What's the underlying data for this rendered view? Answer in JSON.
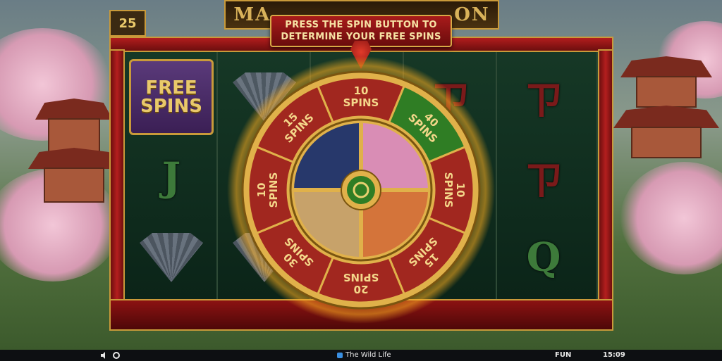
{
  "game": {
    "title_text": "MA",
    "title_text_right": "ON",
    "counter_value": "25",
    "prompt_line1": "PRESS THE SPIN BUTTON TO",
    "prompt_line2": "DETERMINE YOUR FREE SPINS"
  },
  "reels": {
    "symbols": [
      {
        "type": "free_spins",
        "label_top": "FREE",
        "label_bottom": "SPINS"
      },
      {
        "type": "letter",
        "label": "J"
      },
      {
        "type": "fan"
      },
      {
        "type": "fan"
      },
      {
        "type": "letter",
        "label": "Q"
      },
      {
        "type": "letter",
        "label": "ㄗ"
      }
    ],
    "free_spins_top": "FREE",
    "free_spins_bottom": "SPINS",
    "letter_j": "J",
    "letter_q": "Q",
    "letter_red": "ㄗ"
  },
  "wheel": {
    "segments": [
      {
        "amount": "10",
        "unit": "SPINS",
        "color": "#a1271f"
      },
      {
        "amount": "40",
        "unit": "SPINS",
        "color": "#2f7d24"
      },
      {
        "amount": "10",
        "unit": "SPINS",
        "color": "#a1271f"
      },
      {
        "amount": "15",
        "unit": "SPINS",
        "color": "#a1271f"
      },
      {
        "amount": "20",
        "unit": "SPINS",
        "color": "#a1271f"
      },
      {
        "amount": "30",
        "unit": "SPINS",
        "color": "#a1271f"
      },
      {
        "amount": "10",
        "unit": "SPINS",
        "color": "#a1271f"
      },
      {
        "amount": "15",
        "unit": "SPINS",
        "color": "#a1271f"
      }
    ],
    "inner_quadrants": [
      "fan-icon",
      "lotus-icon",
      "koi-fish-icon",
      "scroll-icon"
    ],
    "colors": {
      "gold": "#e0b14a",
      "red": "#a1271f",
      "green": "#2f7d24",
      "text": "#f4d78a"
    }
  },
  "taskbar": {
    "app_name": "The Wild Life",
    "mode": "FUN",
    "time": "15:09"
  }
}
